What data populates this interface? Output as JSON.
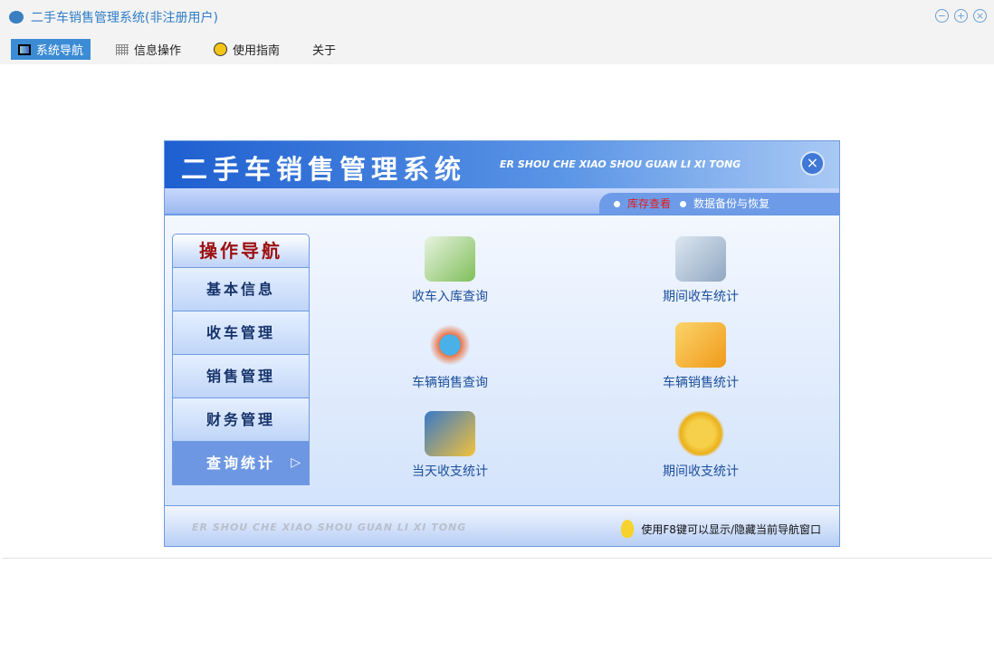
{
  "window": {
    "title": "二手车销售管理系统(非注册用户)"
  },
  "menu": [
    {
      "label": "系统导航",
      "icon": "monitor-icon"
    },
    {
      "label": "信息操作",
      "icon": "grid-icon"
    },
    {
      "label": "使用指南",
      "icon": "help-icon"
    },
    {
      "label": "关于"
    }
  ],
  "panel": {
    "title": "二手车销售管理系统",
    "subtitle": "ER SHOU CHE XIAO SHOU GUAN LI XI TONG",
    "tabs": [
      "库存查看",
      "数据备份与恢复"
    ],
    "nav_title": "操作导航",
    "nav_items": [
      "基本信息",
      "收车管理",
      "销售管理",
      "财务管理",
      "查询统计"
    ],
    "functions": [
      "收车入库查询",
      "期间收车统计",
      "车辆销售查询",
      "车辆销售统计",
      "当天收支统计",
      "期间收支统计"
    ],
    "footer_en": "ER SHOU CHE XIAO SHOU GUAN LI XI TONG",
    "footer_tip": "使用F8键可以显示/隐藏当前导航窗口"
  }
}
